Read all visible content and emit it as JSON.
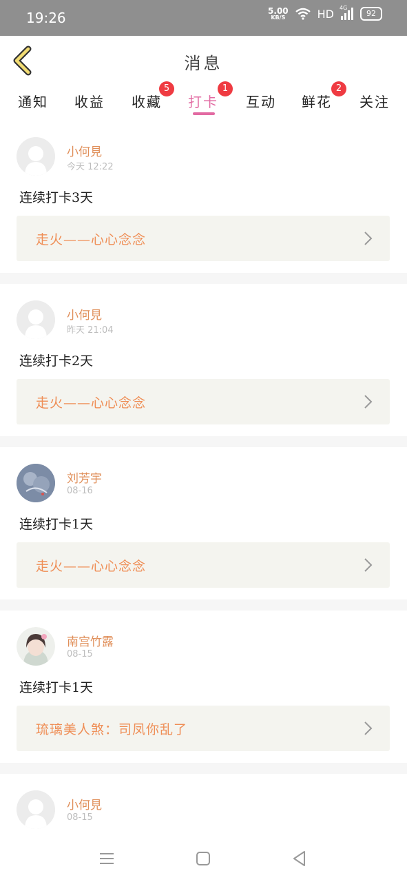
{
  "status_bar": {
    "time": "19:26",
    "net_speed": "5.00",
    "net_unit": "KB/S",
    "hd": "HD",
    "network": "4G",
    "battery": "92"
  },
  "header": {
    "title": "消息",
    "back_icon": "chevron-left-icon"
  },
  "tabs": [
    {
      "label": "通知",
      "badge": ""
    },
    {
      "label": "收益",
      "badge": ""
    },
    {
      "label": "收藏",
      "badge": "5"
    },
    {
      "label": "打卡",
      "badge": "1",
      "active": true
    },
    {
      "label": "互动",
      "badge": ""
    },
    {
      "label": "鲜花",
      "badge": "2"
    },
    {
      "label": "关注",
      "badge": ""
    }
  ],
  "feed": [
    {
      "name": "小何見",
      "time": "今天 12:22",
      "text": "连续打卡3天",
      "card": "走火——心心念念"
    },
    {
      "name": "小何見",
      "time": "昨天 21:04",
      "text": "连续打卡2天",
      "card": "走火——心心念念"
    },
    {
      "name": "刘芳宇",
      "time": "08-16",
      "text": "连续打卡1天",
      "card": "走火——心心念念"
    },
    {
      "name": "南宫竹露",
      "time": "08-15",
      "text": "连续打卡1天",
      "card": "琉璃美人煞：司凤你乱了"
    },
    {
      "name": "小何見",
      "time": "08-15",
      "text": "",
      "card": ""
    }
  ],
  "colors": {
    "accent": "#e26aa2",
    "name": "#e08f5a",
    "card_title": "#ef8e56",
    "badge": "#ef3b42",
    "card_bg": "#f4f4ef"
  }
}
